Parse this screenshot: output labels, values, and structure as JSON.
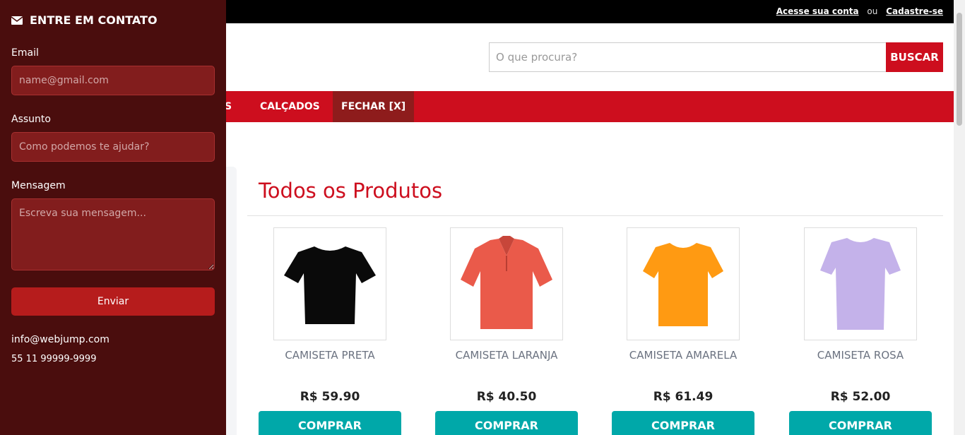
{
  "topbar": {
    "login_link": "Acesse sua conta",
    "separator": "ou",
    "signup_link": "Cadastre-se"
  },
  "search": {
    "placeholder": "O que procura?",
    "button_label": "BUSCAR"
  },
  "nav": {
    "items": [
      {
        "label": "S"
      },
      {
        "label": "CALÇADOS"
      },
      {
        "label": "FECHAR [X]"
      }
    ]
  },
  "catalog": {
    "title": "Todos os Produtos",
    "products": [
      {
        "name": "CAMISETA PRETA",
        "price": "R$ 59.90",
        "button": "COMPRAR",
        "shirt_color": "#0a0a0a",
        "style": "tshirt"
      },
      {
        "name": "CAMISETA LARANJA",
        "price": "R$ 40.50",
        "button": "COMPRAR",
        "shirt_color": "#ea5a4a",
        "style": "polo"
      },
      {
        "name": "CAMISETA AMARELA",
        "price": "R$ 61.49",
        "button": "COMPRAR",
        "shirt_color": "#ff9a12",
        "style": "tshirt"
      },
      {
        "name": "CAMISETA ROSA",
        "price": "R$ 52.00",
        "button": "COMPRAR",
        "shirt_color": "#c4b2ea",
        "style": "tshirt"
      }
    ]
  },
  "contact": {
    "title": "ENTRE EM CONTATO",
    "icon": "envelope-icon",
    "email_label": "Email",
    "email_placeholder": "name@gmail.com",
    "subject_label": "Assunto",
    "subject_placeholder": "Como podemos te ajudar?",
    "message_label": "Mensagem",
    "message_placeholder": "Escreva sua mensagem...",
    "send_label": "Enviar",
    "info_email": "info@webjump.com",
    "info_phone": "55 11 99999-9999"
  },
  "colors": {
    "brand_red": "#cd0e1e",
    "drawer_bg": "#4a0d0d",
    "buy_teal": "#00a8a9"
  }
}
